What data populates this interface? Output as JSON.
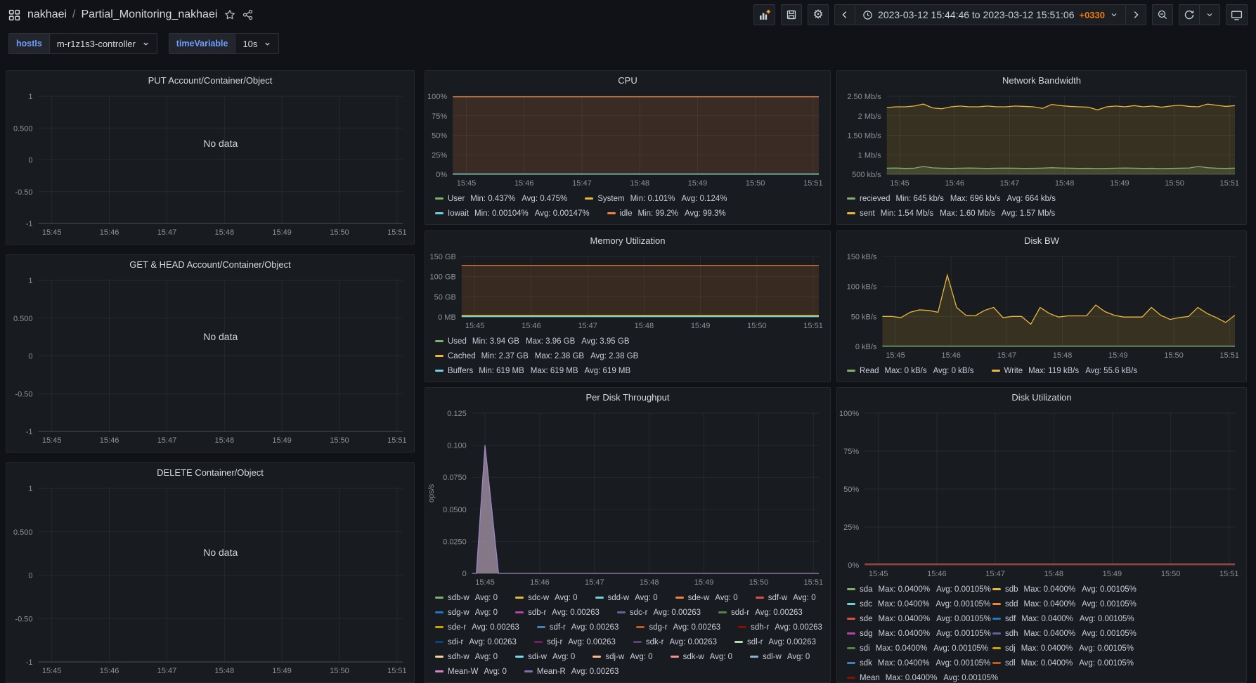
{
  "header": {
    "folder": "nakhaei",
    "separator": "/",
    "dashboard": "Partial_Monitoring_nakhaei",
    "time_range": "2023-03-12 15:44:46 to 2023-03-12 15:51:06",
    "utc_offset": "+0330"
  },
  "variables": [
    {
      "label": "hostIs",
      "value": "m-r1z1s3-controller"
    },
    {
      "label": "timeVariable",
      "value": "10s"
    }
  ],
  "icons": {
    "apps-grid": "grid of four squares",
    "star": "favorite star outline",
    "share": "share-alt nodes",
    "add-panel": "bar chart with orange plus",
    "save": "floppy disk",
    "settings": "gear",
    "settings_glyph": "⚙",
    "clock": "clock face",
    "zoom-out": "magnifier with minus",
    "refresh": "circular arrow",
    "cycle-view": "tv monitor"
  },
  "colors": {
    "accent_orange": "#eb7b18",
    "link_blue": "#6e9fff",
    "panel_bg": "#181b1f",
    "page_bg": "#111217"
  },
  "chart_data": [
    {
      "type": "line",
      "title": "PUT Account/Container/Object",
      "no_data": true,
      "no_data_text": "No data",
      "y_ticks": [
        "1",
        "0.500",
        "0",
        "-0.50",
        "-1"
      ],
      "ylim": [
        -1,
        1
      ],
      "x_ticks": [
        "15:45",
        "15:46",
        "15:47",
        "15:48",
        "15:49",
        "15:50",
        "15:51"
      ],
      "series": [],
      "legend_rows": []
    },
    {
      "type": "line",
      "title": "GET & HEAD Account/Container/Object",
      "no_data": true,
      "no_data_text": "No data",
      "y_ticks": [
        "1",
        "0.500",
        "0",
        "-0.50",
        "-1"
      ],
      "ylim": [
        -1,
        1
      ],
      "x_ticks": [
        "15:45",
        "15:46",
        "15:47",
        "15:48",
        "15:49",
        "15:50",
        "15:51"
      ],
      "series": [],
      "legend_rows": []
    },
    {
      "type": "line",
      "title": "DELETE Container/Object",
      "no_data": true,
      "no_data_text": "No data",
      "y_ticks": [
        "1",
        "0.500",
        "0",
        "-0.50",
        "-1"
      ],
      "ylim": [
        -1,
        1
      ],
      "x_ticks": [
        "15:45",
        "15:46",
        "15:47",
        "15:48",
        "15:49",
        "15:50",
        "15:51"
      ],
      "series": [],
      "legend_rows": []
    },
    {
      "type": "line",
      "title": "CPU",
      "y_ticks": [
        "100%",
        "75%",
        "50%",
        "25%",
        "0%"
      ],
      "ylim": [
        0,
        100
      ],
      "x_ticks": [
        "15:45",
        "15:46",
        "15:47",
        "15:48",
        "15:49",
        "15:50",
        "15:51"
      ],
      "series": [
        {
          "name": "idle",
          "color": "#EF843C",
          "fill": "rgba(239,132,60,0.16)",
          "values": [
            99.3,
            99.3
          ]
        },
        {
          "name": "User",
          "color": "#7EB26D",
          "values": [
            0.48,
            0.48
          ]
        },
        {
          "name": "System",
          "color": "#EAB839",
          "values": [
            0.12,
            0.12
          ]
        },
        {
          "name": "Iowait",
          "color": "#6ED0E0",
          "values": [
            0.2,
            0.2
          ]
        }
      ],
      "legend_rows": [
        [
          {
            "label": "User",
            "color": "#7EB26D",
            "stats": [
              "Min: 0.437%",
              "Avg: 0.475%"
            ]
          },
          {
            "label": "System",
            "color": "#EAB839",
            "stats": [
              "Min: 0.101%",
              "Avg: 0.124%"
            ]
          }
        ],
        [
          {
            "label": "Iowait",
            "color": "#6ED0E0",
            "stats": [
              "Min: 0.00104%",
              "Avg: 0.00147%"
            ]
          },
          {
            "label": "idle",
            "color": "#EF843C",
            "stats": [
              "Min: 99.2%",
              "Avg: 99.3%"
            ]
          }
        ]
      ]
    },
    {
      "type": "line",
      "title": "Memory Utilization",
      "y_ticks": [
        "150 GB",
        "100 GB",
        "50 GB",
        "0 MB"
      ],
      "ylim": [
        0,
        150
      ],
      "x_ticks": [
        "15:45",
        "15:46",
        "15:47",
        "15:48",
        "15:49",
        "15:50",
        "15:51"
      ],
      "series": [
        {
          "name": "",
          "color": "#E0752D",
          "fill": "rgba(224,117,45,0.16)",
          "values": [
            128,
            128
          ]
        },
        {
          "name": "Used",
          "color": "#7EB26D",
          "fill": "rgba(126,178,109,0.28)",
          "values": [
            3.95,
            3.95
          ]
        },
        {
          "name": "Cached",
          "color": "#EAB839",
          "values": [
            2.38,
            2.38
          ]
        },
        {
          "name": "Buffers",
          "color": "#6ED0E0",
          "values": [
            0.62,
            0.62
          ]
        }
      ],
      "legend_rows": [
        [
          {
            "label": "Used",
            "color": "#7EB26D",
            "stats": [
              "Min: 3.94 GB",
              "Max: 3.96 GB",
              "Avg: 3.95 GB"
            ]
          }
        ],
        [
          {
            "label": "Cached",
            "color": "#EAB839",
            "stats": [
              "Min: 2.37 GB",
              "Max: 2.38 GB",
              "Avg: 2.38 GB"
            ]
          }
        ],
        [
          {
            "label": "Buffers",
            "color": "#6ED0E0",
            "stats": [
              "Min: 619 MB",
              "Max: 619 MB",
              "Avg: 619 MB"
            ]
          }
        ]
      ]
    },
    {
      "type": "line",
      "title": "Per Disk Throughput",
      "ylabel": "ops/s",
      "y_ticks": [
        "0.125",
        "0.100",
        "0.0750",
        "0.0500",
        "0.0250",
        "0"
      ],
      "ylim": [
        0,
        0.125
      ],
      "x_ticks": [
        "15:45",
        "15:46",
        "15:47",
        "15:48",
        "15:49",
        "15:50",
        "15:51"
      ],
      "series": [
        {
          "name": "Mean-R",
          "color": "#9B87C5",
          "fill": "rgba(152,136,155,0.85)",
          "x": [
            0,
            0.012,
            0.037,
            0.076,
            1
          ],
          "values": [
            0,
            0,
            0.1,
            0,
            0
          ]
        }
      ],
      "legend_rows": [
        [
          {
            "label": "sdb-w",
            "color": "#7EB26D",
            "stats": [
              "Avg: 0"
            ]
          },
          {
            "label": "sdc-w",
            "color": "#EAB839",
            "stats": [
              "Avg: 0"
            ]
          },
          {
            "label": "sdd-w",
            "color": "#6ED0E0",
            "stats": [
              "Avg: 0"
            ]
          },
          {
            "label": "sde-w",
            "color": "#EF843C",
            "stats": [
              "Avg: 0"
            ]
          },
          {
            "label": "sdf-w",
            "color": "#E24D42",
            "stats": [
              "Avg: 0"
            ]
          }
        ],
        [
          {
            "label": "sdg-w",
            "color": "#1F78C1",
            "stats": [
              "Avg: 0"
            ]
          },
          {
            "label": "sdb-r",
            "color": "#BA43A9",
            "stats": [
              "Avg: 0.00263"
            ]
          },
          {
            "label": "sdc-r",
            "color": "#705DA0",
            "stats": [
              "Avg: 0.00263"
            ]
          },
          {
            "label": "sdd-r",
            "color": "#508642",
            "stats": [
              "Avg: 0.00263"
            ]
          }
        ],
        [
          {
            "label": "sde-r",
            "color": "#CCA300",
            "stats": [
              "Avg: 0.00263"
            ]
          },
          {
            "label": "sdf-r",
            "color": "#447EBC",
            "stats": [
              "Avg: 0.00263"
            ]
          },
          {
            "label": "sdg-r",
            "color": "#C15C17",
            "stats": [
              "Avg: 0.00263"
            ]
          },
          {
            "label": "sdh-r",
            "color": "#890F02",
            "stats": [
              "Avg: 0.00263"
            ]
          }
        ],
        [
          {
            "label": "sdi-r",
            "color": "#0A437C",
            "stats": [
              "Avg: 0.00263"
            ]
          },
          {
            "label": "sdj-r",
            "color": "#6D1F62",
            "stats": [
              "Avg: 0.00263"
            ]
          },
          {
            "label": "sdk-r",
            "color": "#584477",
            "stats": [
              "Avg: 0.00263"
            ]
          },
          {
            "label": "sdl-r",
            "color": "#B7DBAB",
            "stats": [
              "Avg: 0.00263"
            ]
          }
        ],
        [
          {
            "label": "sdh-w",
            "color": "#F4D598",
            "stats": [
              "Avg: 0"
            ]
          },
          {
            "label": "sdi-w",
            "color": "#70DBED",
            "stats": [
              "Avg: 0"
            ]
          },
          {
            "label": "sdj-w",
            "color": "#F9BA8F",
            "stats": [
              "Avg: 0"
            ]
          },
          {
            "label": "sdk-w",
            "color": "#F29191",
            "stats": [
              "Avg: 0"
            ]
          },
          {
            "label": "sdl-w",
            "color": "#82B5D8",
            "stats": [
              "Avg: 0"
            ]
          }
        ],
        [
          {
            "label": "Mean-W",
            "color": "#D683CE",
            "stats": [
              "Avg: 0"
            ]
          },
          {
            "label": "Mean-R",
            "color": "#806EB7",
            "stats": [
              "Avg: 0.00263"
            ]
          }
        ]
      ]
    },
    {
      "type": "line",
      "title": "Network Bandwidth",
      "y_ticks": [
        "2.50 Mb/s",
        "2 Mb/s",
        "1.50 Mb/s",
        "1 Mb/s",
        "500 kb/s"
      ],
      "ylim": [
        500,
        2500
      ],
      "x_ticks": [
        "15:45",
        "15:46",
        "15:47",
        "15:48",
        "15:49",
        "15:50",
        "15:51"
      ],
      "series": [
        {
          "name": "sent",
          "color": "#EAB839",
          "fill": "rgba(234,184,57,0.15)",
          "values": [
            2210,
            2230,
            2230,
            2250,
            2300,
            2200,
            2180,
            2230,
            2250,
            2230,
            2230,
            2250,
            2230,
            2230,
            2250,
            2240,
            2230,
            2190,
            2290,
            2260,
            2240,
            2230,
            2220,
            2150,
            2230,
            2250,
            2230,
            2260,
            2230,
            2250,
            2220,
            2250,
            2270,
            2240,
            2230,
            2300,
            2270,
            2240,
            2260
          ]
        },
        {
          "name": "recieved",
          "color": "#7EB26D",
          "fill": "rgba(126,178,109,0.18)",
          "values": [
            655,
            660,
            650,
            655,
            700,
            665,
            655,
            650,
            655,
            660,
            655,
            650,
            655,
            658,
            655,
            650,
            652,
            658,
            668,
            660,
            655,
            650,
            652,
            645,
            650,
            655,
            660,
            655,
            650,
            652,
            645,
            650,
            655,
            660,
            700,
            668,
            655,
            650,
            658
          ]
        }
      ],
      "legend_rows": [
        [
          {
            "label": "recieved",
            "color": "#7EB26D",
            "stats": [
              "Min: 645 kb/s",
              "Max: 696 kb/s",
              "Avg: 664 kb/s"
            ]
          }
        ],
        [
          {
            "label": "sent",
            "color": "#EAB839",
            "stats": [
              "Min: 1.54 Mb/s",
              "Max: 1.60 Mb/s",
              "Avg: 1.57 Mb/s"
            ]
          }
        ]
      ]
    },
    {
      "type": "line",
      "title": "Disk BW",
      "y_ticks": [
        "150 kB/s",
        "100 kB/s",
        "50 kB/s",
        "0 kB/s"
      ],
      "ylim": [
        0,
        150
      ],
      "x_ticks": [
        "15:45",
        "15:46",
        "15:47",
        "15:48",
        "15:49",
        "15:50",
        "15:51"
      ],
      "series": [
        {
          "name": "Write",
          "color": "#EAB839",
          "fill": "rgba(234,184,57,0.15)",
          "values": [
            50,
            50,
            48,
            57,
            61,
            60,
            57,
            119,
            65,
            52,
            51,
            60,
            65,
            48,
            50,
            50,
            37,
            65,
            55,
            49,
            51,
            51,
            51,
            69,
            58,
            52,
            49,
            49,
            49,
            65,
            52,
            45,
            48,
            50,
            65,
            55,
            48,
            40,
            52
          ]
        },
        {
          "name": "Read",
          "color": "#7EB26D",
          "values": [
            0.5,
            0.5
          ]
        }
      ],
      "legend_rows": [
        [
          {
            "label": "Read",
            "color": "#7EB26D",
            "stats": [
              "Max: 0 kB/s",
              "Avg: 0 kB/s"
            ]
          },
          {
            "label": "Write",
            "color": "#EAB839",
            "stats": [
              "Max: 119 kB/s",
              "Avg: 55.6 kB/s"
            ]
          }
        ]
      ]
    },
    {
      "type": "line",
      "title": "Disk Utilization",
      "y_ticks": [
        "100%",
        "75%",
        "50%",
        "25%",
        "0%"
      ],
      "ylim": [
        0,
        100
      ],
      "x_ticks": [
        "15:45",
        "15:46",
        "15:47",
        "15:48",
        "15:49",
        "15:50",
        "15:51"
      ],
      "series": [
        {
          "name": "Mean",
          "color": "#E24D42",
          "values": [
            0.6,
            0.6
          ]
        }
      ],
      "legend_fixed": true,
      "legend_max_height": 138,
      "legend_rows": [
        [
          {
            "label": "sda",
            "color": "#7EB26D",
            "stats": [
              "Max: 0.0400%",
              "Avg: 0.00105%"
            ]
          },
          {
            "label": "sdb",
            "color": "#EAB839",
            "stats": [
              "Max: 0.0400%",
              "Avg: 0.00105%"
            ]
          }
        ],
        [
          {
            "label": "sdc",
            "color": "#6ED0E0",
            "stats": [
              "Max: 0.0400%",
              "Avg: 0.00105%"
            ]
          },
          {
            "label": "sdd",
            "color": "#EF843C",
            "stats": [
              "Max: 0.0400%",
              "Avg: 0.00105%"
            ]
          }
        ],
        [
          {
            "label": "sde",
            "color": "#E24D42",
            "stats": [
              "Max: 0.0400%",
              "Avg: 0.00105%"
            ]
          },
          {
            "label": "sdf",
            "color": "#1F78C1",
            "stats": [
              "Max: 0.0400%",
              "Avg: 0.00105%"
            ]
          }
        ],
        [
          {
            "label": "sdg",
            "color": "#BA43A9",
            "stats": [
              "Max: 0.0400%",
              "Avg: 0.00105%"
            ]
          },
          {
            "label": "sdh",
            "color": "#705DA0",
            "stats": [
              "Max: 0.0400%",
              "Avg: 0.00105%"
            ]
          }
        ],
        [
          {
            "label": "sdi",
            "color": "#508642",
            "stats": [
              "Max: 0.0400%",
              "Avg: 0.00105%"
            ]
          },
          {
            "label": "sdj",
            "color": "#CCA300",
            "stats": [
              "Max: 0.0400%",
              "Avg: 0.00105%"
            ]
          }
        ],
        [
          {
            "label": "sdk",
            "color": "#447EBC",
            "stats": [
              "Max: 0.0400%",
              "Avg: 0.00105%"
            ]
          },
          {
            "label": "sdl",
            "color": "#C15C17",
            "stats": [
              "Max: 0.0400%",
              "Avg: 0.00105%"
            ]
          }
        ],
        [
          {
            "label": "Mean",
            "color": "#890F02",
            "stats": [
              "Max: 0.0400%",
              "Avg: 0.00105%"
            ]
          }
        ]
      ]
    }
  ]
}
